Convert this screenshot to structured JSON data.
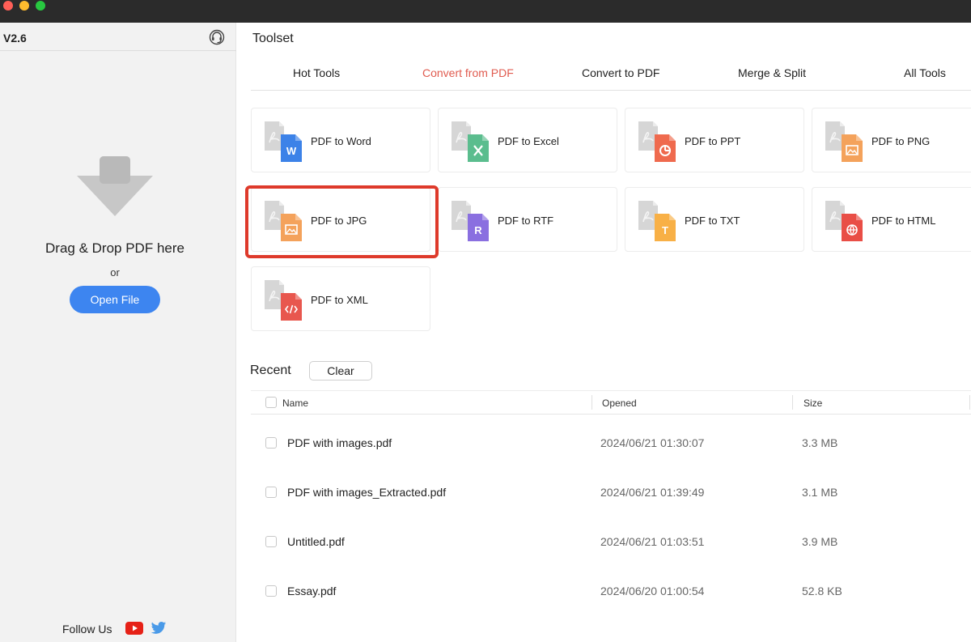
{
  "window": {
    "traffic_lights": {
      "close": "#ff5f57",
      "minimize": "#febc2e",
      "zoom": "#28c840"
    }
  },
  "sidebar": {
    "version": "V2.6",
    "support_icon": "headset-icon",
    "drop_text": "Drag & Drop PDF here",
    "or_text": "or",
    "open_file_label": "Open File",
    "follow_label": "Follow Us",
    "social_icons": [
      "youtube-icon",
      "twitter-icon"
    ]
  },
  "toolset": {
    "title": "Toolset",
    "tabs": [
      {
        "label": "Hot Tools",
        "active": false
      },
      {
        "label": "Convert from PDF",
        "active": true
      },
      {
        "label": "Convert to PDF",
        "active": false
      },
      {
        "label": "Merge & Split",
        "active": false
      },
      {
        "label": "All Tools",
        "active": false
      }
    ],
    "tools": [
      {
        "label": "PDF to Word",
        "icon": "word-file-icon",
        "color": "#3c82e8",
        "highlighted": false
      },
      {
        "label": "PDF to Excel",
        "icon": "excel-file-icon",
        "color": "#5bbd8e",
        "highlighted": false
      },
      {
        "label": "PDF to PPT",
        "icon": "ppt-file-icon",
        "color": "#ef6a4e",
        "highlighted": false
      },
      {
        "label": "PDF to PNG",
        "icon": "png-file-icon",
        "color": "#f4a25b",
        "highlighted": false
      },
      {
        "label": "PDF to JPG",
        "icon": "jpg-file-icon",
        "color": "#f4a25b",
        "highlighted": true
      },
      {
        "label": "PDF to RTF",
        "icon": "rtf-file-icon",
        "color": "#8a6fe0",
        "highlighted": false
      },
      {
        "label": "PDF to TXT",
        "icon": "txt-file-icon",
        "color": "#f8b046",
        "highlighted": false
      },
      {
        "label": "PDF to HTML",
        "icon": "html-file-icon",
        "color": "#e94e46",
        "highlighted": false
      },
      {
        "label": "PDF to XML",
        "icon": "xml-file-icon",
        "color": "#e8574e",
        "highlighted": false
      }
    ]
  },
  "recent": {
    "title": "Recent",
    "clear_label": "Clear",
    "columns": {
      "name": "Name",
      "opened": "Opened",
      "size": "Size"
    },
    "files": [
      {
        "name": "PDF with images.pdf",
        "opened": "2024/06/21 01:30:07",
        "size": "3.3 MB"
      },
      {
        "name": "PDF with images_Extracted.pdf",
        "opened": "2024/06/21 01:39:49",
        "size": "3.1 MB"
      },
      {
        "name": "Untitled.pdf",
        "opened": "2024/06/21 01:03:51",
        "size": "3.9 MB"
      },
      {
        "name": "Essay.pdf",
        "opened": "2024/06/20 01:00:54",
        "size": "52.8 KB"
      }
    ]
  }
}
